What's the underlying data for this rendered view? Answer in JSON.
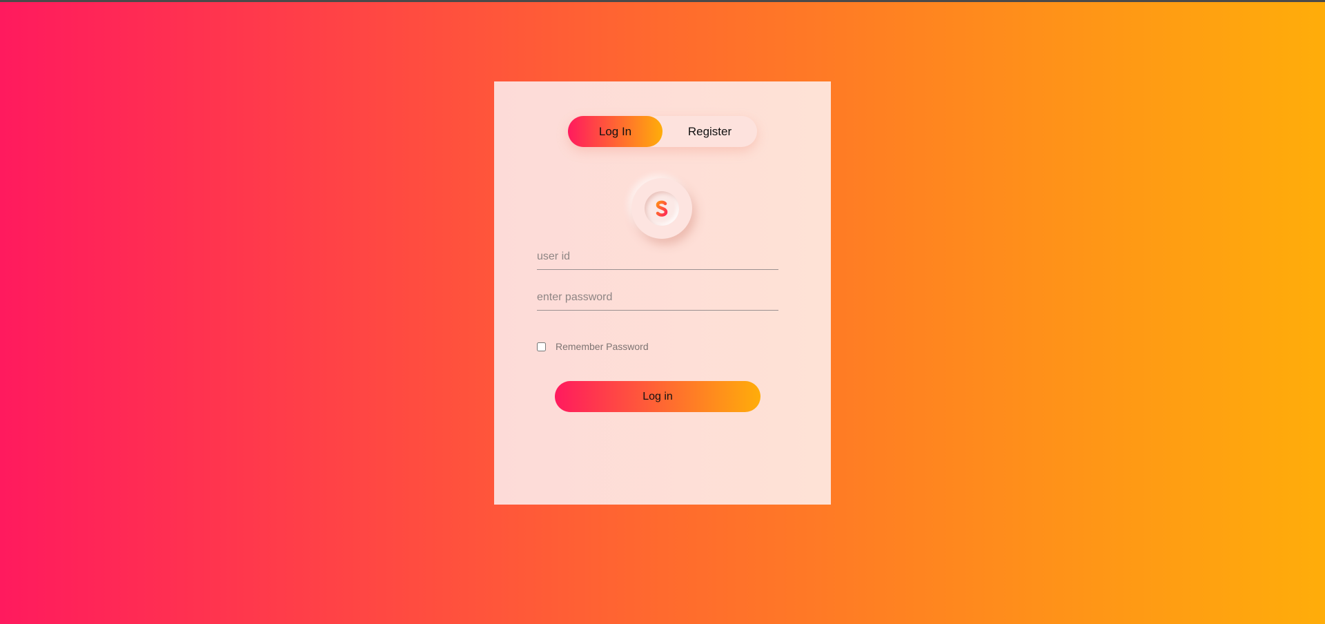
{
  "tabs": {
    "login_label": "Log In",
    "register_label": "Register",
    "active": "login"
  },
  "logo": {
    "icon": "s-logo-icon"
  },
  "form": {
    "user_placeholder": "user id",
    "password_placeholder": "enter password",
    "remember_label": "Remember Password",
    "remember_checked": false,
    "submit_label": "Log in"
  },
  "colors": {
    "gradient_start": "#ff1a5e",
    "gradient_end": "#ffad0a",
    "card_background": "#fddfd8"
  }
}
